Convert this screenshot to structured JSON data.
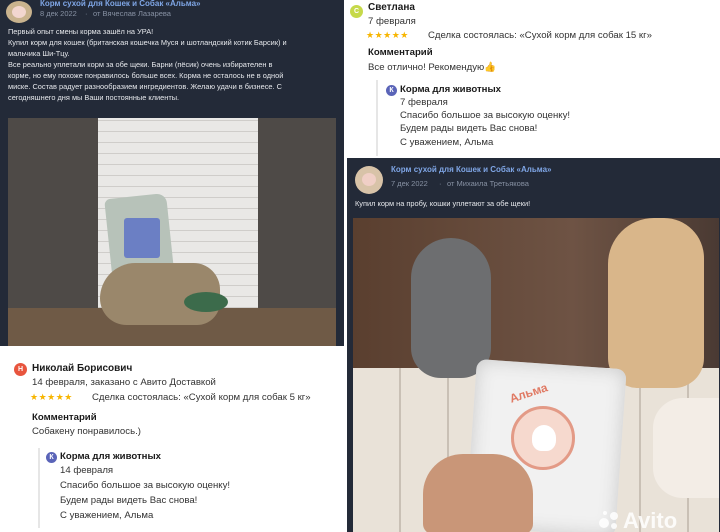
{
  "vk_post_1": {
    "group_name": "Корм сухой для Кошек и Собак «Альма»",
    "date": "8 дек 2022",
    "author": "от Вячеслав Лазарева",
    "text_lines": [
      "Первый опыт смены корма зашёл на УРА!",
      "Купил корм для кошек (британская кошечка Муся и шотландский котик Барсик) и",
      "мальчика Ши-Тцу.",
      "Все реально уплетали корм за обе щеки. Барни (пёсик) очень избирателен в",
      "корме, но ему похоже понравилось больше всех. Корма не осталось не в одной",
      "миске. Состав радует разнообразием ингредиентов. Желаю удачи в бизнесе. С",
      "сегодняшнего дня мы Ваши постоянные клиенты."
    ]
  },
  "review_1": {
    "initial": "Н",
    "initial_color": "#e8553e",
    "reviewer": "Николай Борисович",
    "meta": "14 февраля, заказано с Авито Доставкой",
    "stars": "★★★★★",
    "deal": "Сделка состоялась: «Сухой корм для собак 5 кг»",
    "comment_title": "Комментарий",
    "comment": "Собакену понравилось.)",
    "reply": {
      "shop": "Корма для животных",
      "date": "14 февраля",
      "lines": [
        "Спасибо большое за высокую оценку!",
        "Будем рады видеть Вас снова!",
        "С уважением, Альма"
      ]
    }
  },
  "review_2": {
    "initial": "С",
    "initial_color": "#c6d94a",
    "reviewer": "Светлана",
    "meta": "7 февраля",
    "stars": "★★★★★",
    "deal": "Сделка состоялась: «Сухой корм для собак 15 кг»",
    "comment_title": "Комментарий",
    "comment": "Все отлично! Рекомендую👍",
    "reply": {
      "shop": "Корма для животных",
      "date": "7 февраля",
      "lines": [
        "Спасибо большое за высокую оценку!",
        "Будем рады видеть Вас снова!",
        "С уважением, Альма"
      ]
    }
  },
  "vk_post_2": {
    "group_name": "Корм сухой для Кошек и Собак «Альма»",
    "date": "7 дек 2022",
    "author": "от Михаила Третьякова",
    "text": "Купил корм на пробу, кошки уплетают за обе щеки!",
    "pack_label": "Альма",
    "watermark": "Avito"
  }
}
